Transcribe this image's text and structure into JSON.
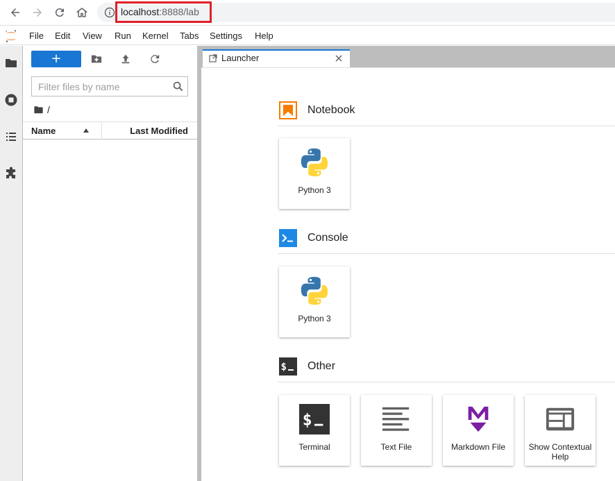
{
  "browser": {
    "url_host": "localhost",
    "url_rest": ":8888/lab",
    "icons": [
      "back-arrow-icon",
      "forward-arrow-icon",
      "reload-icon",
      "home-icon",
      "info-icon"
    ]
  },
  "menubar": {
    "items": [
      "File",
      "Edit",
      "View",
      "Run",
      "Kernel",
      "Tabs",
      "Settings",
      "Help"
    ]
  },
  "activity_bar": {
    "icons": [
      "folder-icon",
      "running-stop-icon",
      "toc-list-icon",
      "extension-puzzle-icon"
    ]
  },
  "filebrowser": {
    "new_label": "+",
    "filter_placeholder": "Filter files by name",
    "breadcrumb": "/",
    "columns": {
      "name": "Name",
      "modified": "Last Modified"
    }
  },
  "tabs": [
    {
      "label": "Launcher",
      "active": true
    }
  ],
  "launcher": {
    "sections": [
      {
        "title": "Notebook",
        "icon": "notebook-icon",
        "cards": [
          {
            "label": "Python 3",
            "icon": "python-logo-icon"
          }
        ]
      },
      {
        "title": "Console",
        "icon": "console-icon",
        "cards": [
          {
            "label": "Python 3",
            "icon": "python-logo-icon"
          }
        ]
      },
      {
        "title": "Other",
        "icon": "terminal-dollar-icon",
        "cards": [
          {
            "label": "Terminal",
            "icon": "terminal-icon"
          },
          {
            "label": "Text File",
            "icon": "text-file-icon"
          },
          {
            "label": "Markdown File",
            "icon": "markdown-icon"
          },
          {
            "label": "Show Contextual Help",
            "icon": "contextual-help-icon"
          }
        ]
      }
    ]
  },
  "colors": {
    "accent": "#1976d2",
    "highlight_box": "#e0202a",
    "notebook_orange": "#f57c00",
    "console_blue": "#1e88e5",
    "markdown_purple": "#7b1fa2",
    "dark_icon": "#333333"
  }
}
